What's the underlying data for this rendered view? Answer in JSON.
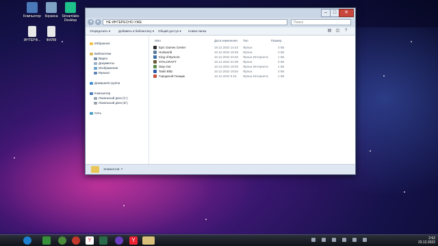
{
  "desktop": {
    "icons": [
      {
        "label": "Компьютер",
        "color": "#4a78b8"
      },
      {
        "label": "Корзина",
        "color": "#7fa2c4"
      },
      {
        "label": "Streamlabs Desktop",
        "color": "#1fc18a"
      },
      {
        "label": "ИНТЕРФ...",
        "color": "#e8e8e8"
      },
      {
        "label": "ФИЛМ",
        "color": "#e8e8e8"
      }
    ]
  },
  "window": {
    "address": "НЕ ИНТЕРЕСНО УЖЕ",
    "search_placeholder": "Поиск",
    "toolbar": {
      "organize": "Упорядочить ▾",
      "add_to_library": "Добавить в библиотеку ▾",
      "share": "Общий доступ ▾",
      "new_folder": "Новая папка"
    },
    "nav": {
      "favorites": "Избранное",
      "libraries": "Библиотеки",
      "video": "Видео",
      "documents": "Документы",
      "images": "Изображения",
      "music": "Музыка",
      "homegroup": "Домашняя группа",
      "computer": "Компьютер",
      "disk_c": "Локальный диск (C:)",
      "disk_d": "Локальный диск (D:)",
      "network": "Сеть"
    },
    "columns": {
      "name": "Имя",
      "date": "Дата изменения",
      "type": "Тип",
      "size": "Размер"
    },
    "files": [
      {
        "name": "Epic Games Center",
        "date": "18.12.2022 14:43",
        "type": "Ярлык",
        "size": "3 КБ",
        "color": "#2b2b2b"
      },
      {
        "name": "Hurtworld",
        "date": "10.12.2022 18:49",
        "type": "Ярлык",
        "size": "3 КБ",
        "color": "#5a7a9a"
      },
      {
        "name": "King of Bymore",
        "date": "10.12.2022 23:40",
        "type": "Ярлык Интернета",
        "size": "1 КБ",
        "color": "#3c6ea8"
      },
      {
        "name": "STALCRAFT",
        "date": "10.12.2022 21:08",
        "type": "Ярлык",
        "size": "3 КБ",
        "color": "#6a5a3a"
      },
      {
        "name": "Stay Out",
        "date": "10.12.2022 19:03",
        "type": "Ярлык Интернета",
        "size": "1 КБ",
        "color": "#5c8a4a"
      },
      {
        "name": "Tanki Blitz",
        "date": "10.12.2022 19:54",
        "type": "Ярлык",
        "size": "3 КБ",
        "color": "#2e5da8"
      },
      {
        "name": "Городской Гонщик",
        "date": "10.12.2022 9:16",
        "type": "Ярлык Интернета",
        "size": "1 КБ",
        "color": "#c8503c"
      }
    ],
    "status": "Элементов: 7"
  },
  "taskbar": {
    "time": "2:52",
    "date": "23.12.2022",
    "apps": [
      "start",
      "chrome",
      "explorer",
      "utorrent",
      "yandex",
      "media",
      "streamlabs",
      "viber",
      "yandex2",
      "explorer-folder"
    ]
  }
}
